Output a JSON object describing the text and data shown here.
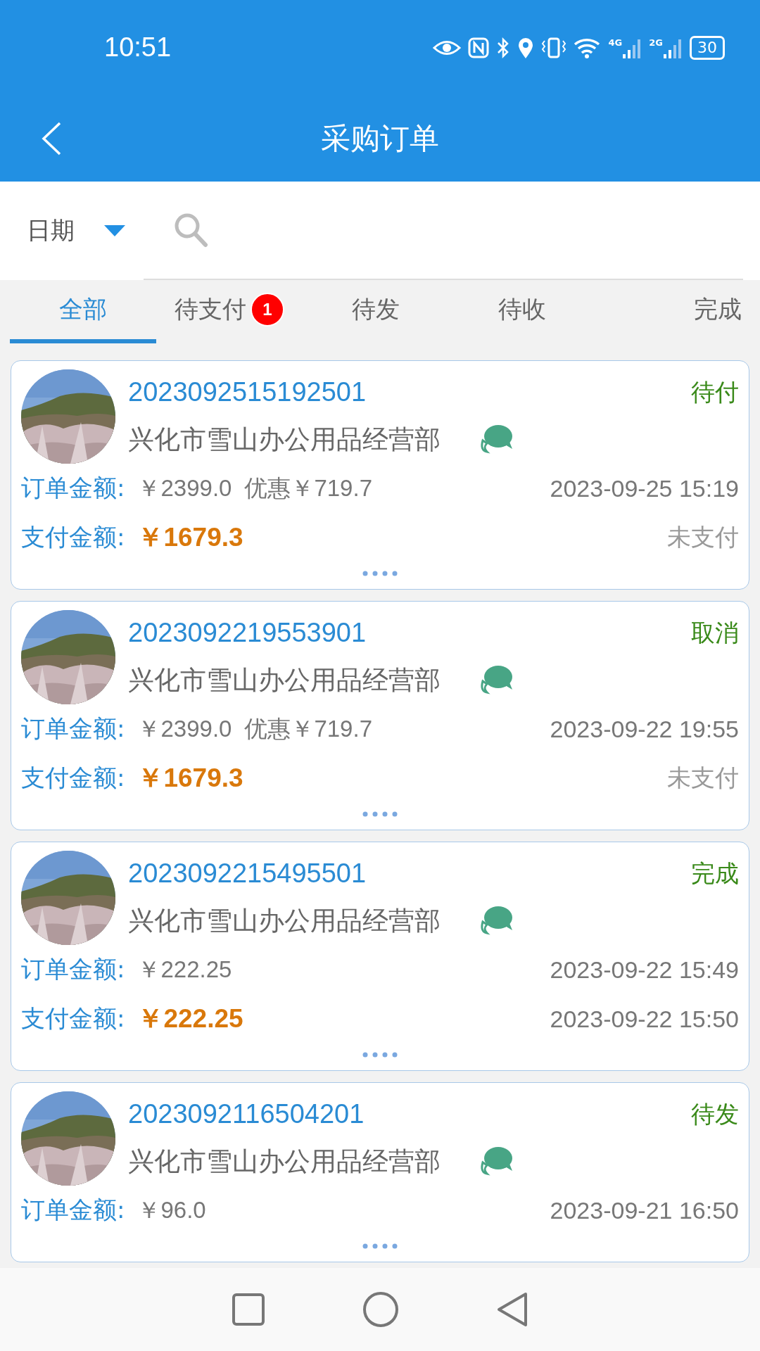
{
  "status_bar": {
    "time": "10:51",
    "battery": "30",
    "net_1": "4G",
    "net_2": "2G"
  },
  "header": {
    "title": "采购订单"
  },
  "filter": {
    "date_label": "日期"
  },
  "tabs": [
    {
      "label": "全部",
      "selected": true
    },
    {
      "label": "待支付",
      "selected": false,
      "badge": "1"
    },
    {
      "label": "待发",
      "selected": false
    },
    {
      "label": "待收",
      "selected": false
    },
    {
      "label": "完成",
      "selected": false
    }
  ],
  "orders": [
    {
      "order_no": "2023092515192501",
      "status": "待付",
      "shop": "兴化市雪山办公用品经营部",
      "order_label": "订单金额:",
      "order_amount": "￥2399.0",
      "discount": "优惠￥719.7",
      "order_time": "2023-09-25 15:19",
      "pay_label": "支付金额:",
      "pay_amount": "￥1679.3",
      "pay_note": "未支付"
    },
    {
      "order_no": "2023092219553901",
      "status": "取消",
      "shop": "兴化市雪山办公用品经营部",
      "order_label": "订单金额:",
      "order_amount": "￥2399.0",
      "discount": "优惠￥719.7",
      "order_time": "2023-09-22 19:55",
      "pay_label": "支付金额:",
      "pay_amount": "￥1679.3",
      "pay_note": "未支付"
    },
    {
      "order_no": "2023092215495501",
      "status": "完成",
      "shop": "兴化市雪山办公用品经营部",
      "order_label": "订单金额:",
      "order_amount": "￥222.25",
      "order_time": "2023-09-22 15:49",
      "pay_label": "支付金额:",
      "pay_amount": "￥222.25",
      "pay_time": "2023-09-22 15:50"
    },
    {
      "order_no": "2023092116504201",
      "status": "待发",
      "shop": "兴化市雪山办公用品经营部",
      "order_label": "订单金额:",
      "order_amount": "￥96.0",
      "order_time": "2023-09-21 16:50"
    }
  ]
}
